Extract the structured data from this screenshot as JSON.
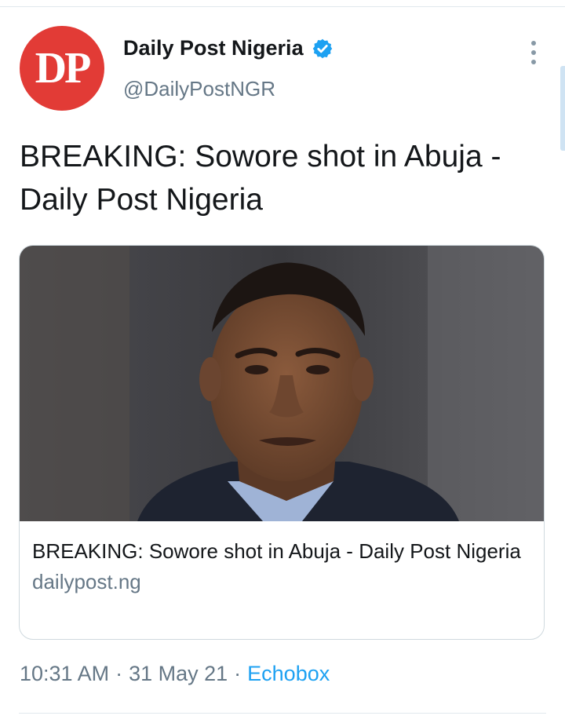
{
  "account": {
    "avatar_text": "DP",
    "display_name": "Daily Post Nigeria",
    "handle": "@DailyPostNGR",
    "verified": true
  },
  "tweet": {
    "text": "BREAKING: Sowore shot in Abuja - Daily Post Nigeria"
  },
  "card": {
    "image_description": "portrait-photo",
    "title": "BREAKING: Sowore shot in Abuja - Daily Post Nigeria",
    "domain": "dailypost.ng"
  },
  "meta": {
    "time": "10:31 AM",
    "separator": "·",
    "date": "31 May 21",
    "source": "Echobox"
  },
  "colors": {
    "avatar_bg": "#e23b36",
    "verified_badge": "#1da1f2",
    "secondary_text": "#657786",
    "link": "#1da1f2"
  }
}
